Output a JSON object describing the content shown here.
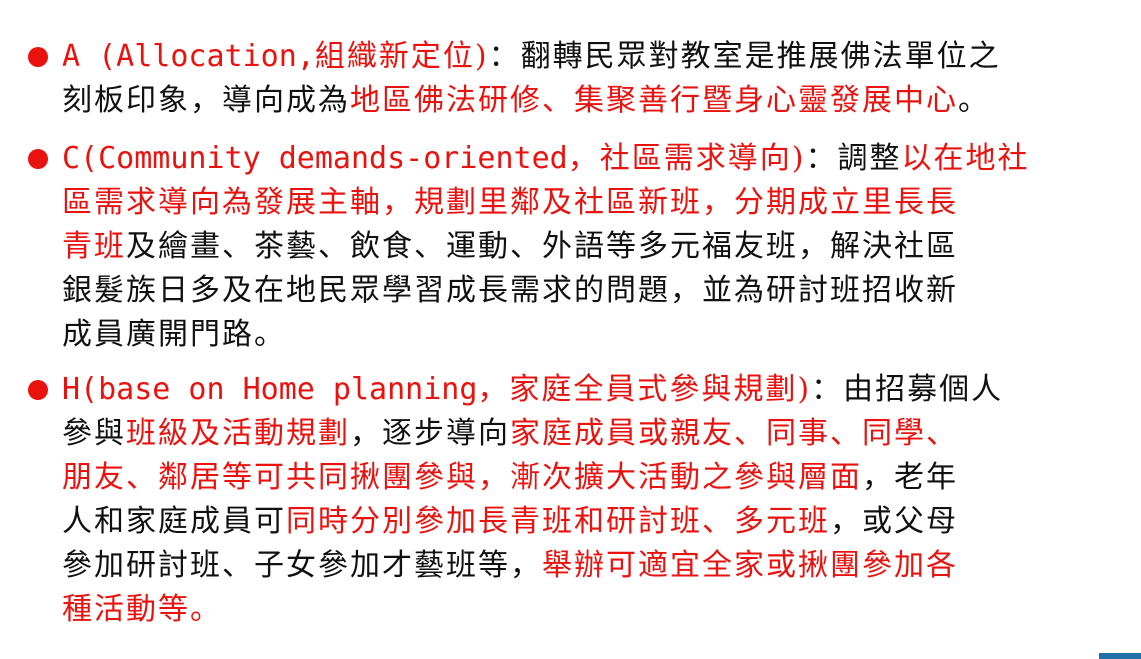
{
  "items": [
    {
      "lines": [
        [
          {
            "t": "A (Allocation,",
            "c": "r",
            "f": "mono"
          },
          {
            "t": "組織新定位)",
            "c": "r"
          },
          {
            "t": "：翻轉民眾對教室是推展佛法單位之",
            "c": "k"
          }
        ],
        [
          {
            "t": "刻板印象，導向成為",
            "c": "k"
          },
          {
            "t": "地區佛法研修、集聚善行暨身心靈發展中心",
            "c": "r"
          },
          {
            "t": "。",
            "c": "k"
          }
        ]
      ]
    },
    {
      "lines": [
        [
          {
            "t": "C(Community demands-oriented",
            "c": "r",
            "f": "mono"
          },
          {
            "t": "，社區需求導向)",
            "c": "r"
          },
          {
            "t": "：調整",
            "c": "k"
          },
          {
            "t": "以在地社",
            "c": "r"
          }
        ],
        [
          {
            "t": "區需求導向為發展主軸，規劃里鄰及社區新班，分期成立里長長",
            "c": "r"
          }
        ],
        [
          {
            "t": "青班",
            "c": "r"
          },
          {
            "t": "及繪畫、茶藝、飲食、運動、外語等多元福友班，解決社區",
            "c": "k"
          }
        ],
        [
          {
            "t": "銀髮族日多及在地民眾學習成長需求的問題，並為研討班招收新",
            "c": "k"
          }
        ],
        [
          {
            "t": "成員廣開門路。",
            "c": "k"
          }
        ]
      ]
    },
    {
      "lines": [
        [
          {
            "t": "H(base on Home planning",
            "c": "r",
            "f": "mono"
          },
          {
            "t": "，家庭全員式參與規劃)",
            "c": "r"
          },
          {
            "t": "：由招募個人",
            "c": "k"
          }
        ],
        [
          {
            "t": "參與",
            "c": "k"
          },
          {
            "t": "班級及活動規劃",
            "c": "r"
          },
          {
            "t": "，逐步導向",
            "c": "k"
          },
          {
            "t": "家庭成員或親友、同事、同學、",
            "c": "r"
          }
        ],
        [
          {
            "t": "朋友、鄰居等可共同揪團參與，漸次擴大活動之參與層面",
            "c": "r"
          },
          {
            "t": "，老年",
            "c": "k"
          }
        ],
        [
          {
            "t": "人和家庭成員可",
            "c": "k"
          },
          {
            "t": "同時分別參加長青班和研討班、多元班",
            "c": "r"
          },
          {
            "t": "，或父母",
            "c": "k"
          }
        ],
        [
          {
            "t": "參加研討班、子女參加才藝班等，",
            "c": "k"
          },
          {
            "t": "舉辦可適宜全家或揪團參加各",
            "c": "r"
          }
        ],
        [
          {
            "t": "種活動等。",
            "c": "r"
          }
        ]
      ]
    }
  ],
  "colors": {
    "red": "#e8130f",
    "text": "#111111",
    "bullet": "#e8130f"
  }
}
